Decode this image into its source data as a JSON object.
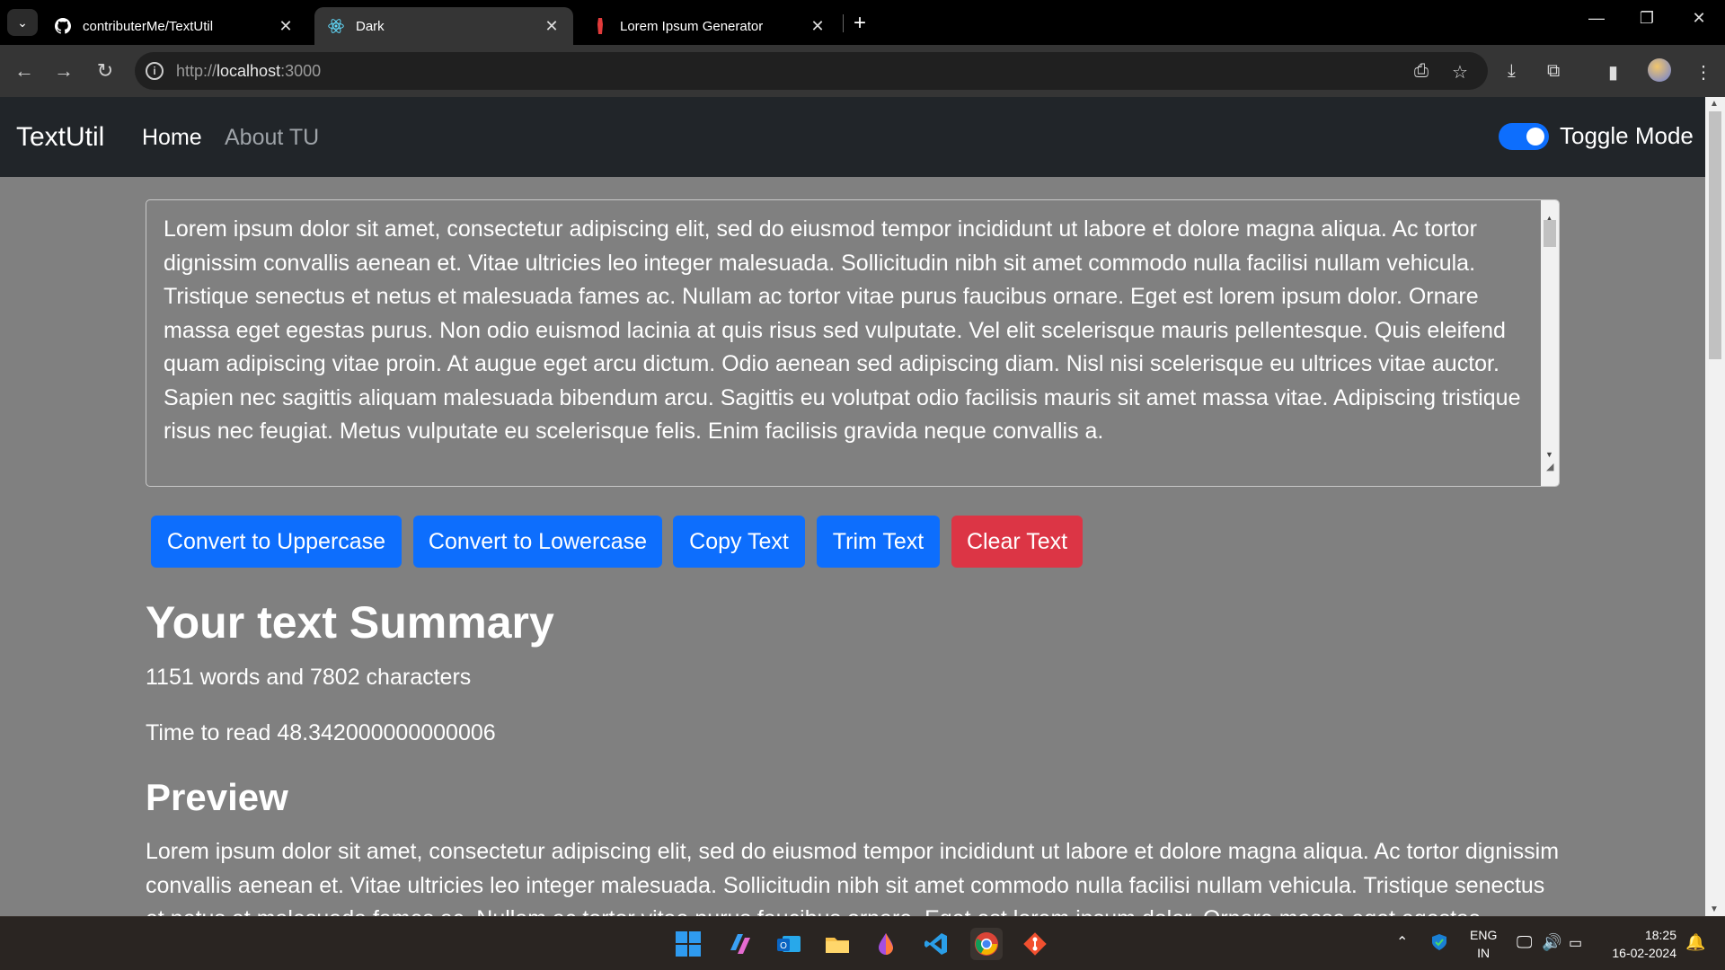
{
  "browser": {
    "tabs": [
      {
        "title": "contributerMe/TextUtil",
        "icon": "github-icon"
      },
      {
        "title": "Dark",
        "icon": "react-icon"
      },
      {
        "title": "Lorem Ipsum Generator",
        "icon": "lorem-ipsum-icon"
      }
    ],
    "url_prefix": "http://",
    "url_host": "localhost",
    "url_port": ":3000"
  },
  "app": {
    "brand": "TextUtil",
    "nav": [
      {
        "label": "Home"
      },
      {
        "label": "About TU"
      }
    ],
    "toggle_label": "Toggle Mode",
    "textarea_value": "Lorem ipsum dolor sit amet, consectetur adipiscing elit, sed do eiusmod tempor incididunt ut labore et dolore magna aliqua. Ac tortor dignissim convallis aenean et. Vitae ultricies leo integer malesuada. Sollicitudin nibh sit amet commodo nulla facilisi nullam vehicula. Tristique senectus et netus et malesuada fames ac. Nullam ac tortor vitae purus faucibus ornare. Eget est lorem ipsum dolor. Ornare massa eget egestas purus. Non odio euismod lacinia at quis risus sed vulputate. Vel elit scelerisque mauris pellentesque. Quis eleifend quam adipiscing vitae proin. At augue eget arcu dictum. Odio aenean sed adipiscing diam. Nisl nisi scelerisque eu ultrices vitae auctor. Sapien nec sagittis aliquam malesuada bibendum arcu. Sagittis eu volutpat odio facilisis mauris sit amet massa vitae. Adipiscing tristique risus nec feugiat. Metus vulputate eu scelerisque felis. Enim facilisis gravida neque convallis a.",
    "buttons": {
      "uppercase": "Convert to Uppercase",
      "lowercase": "Convert to Lowercase",
      "copy": "Copy Text",
      "trim": "Trim Text",
      "clear": "Clear Text"
    },
    "summary_heading": "Your text Summary",
    "summary_counts": "1151 words and 7802 characters",
    "read_time": "Time to read 48.342000000000006",
    "preview_heading": "Preview",
    "preview_text": "Lorem ipsum dolor sit amet, consectetur adipiscing elit, sed do eiusmod tempor incididunt ut labore et dolore magna aliqua. Ac tortor dignissim convallis aenean et. Vitae ultricies leo integer malesuada. Sollicitudin nibh sit amet commodo nulla facilisi nullam vehicula. Tristique senectus et netus et malesuada fames ac. Nullam ac tortor vitae purus faucibus ornare. Eget est lorem ipsum dolor. Ornare massa eget egestas"
  },
  "taskbar": {
    "lang_line1": "ENG",
    "lang_line2": "IN",
    "time": "18:25",
    "date": "16-02-2024"
  },
  "colors": {
    "primary": "#0d6efd",
    "danger": "#dc3545",
    "page_bg": "#808080",
    "navbar_bg": "#212529"
  }
}
